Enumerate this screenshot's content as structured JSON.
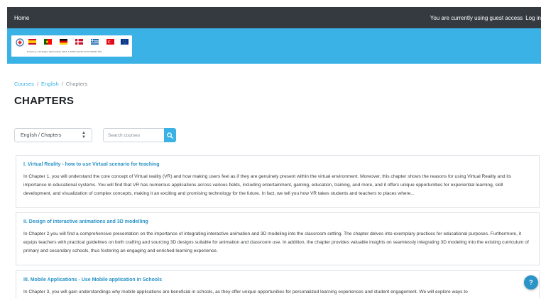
{
  "navbar": {
    "home_label": "Home",
    "guest_text": "You are currently using guest access",
    "login_label": "Log in"
  },
  "banner": {
    "logo_caption": "Erasmus+ Strategic Partnership 2021-1-DE03-KA210-SCH-000027726",
    "flag_icons": [
      "spain-flag-icon",
      "portugal-flag-icon",
      "germany-flag-icon",
      "denmark-flag-icon",
      "greece-flag-icon",
      "turkey-flag-icon",
      "eu-flag-icon"
    ]
  },
  "breadcrumb": {
    "items": [
      "Courses",
      "English",
      "Chapters"
    ],
    "separator": "/"
  },
  "page_title": "CHAPTERS",
  "filter": {
    "category_selected": "English / Chapters",
    "search_placeholder": "Search courses"
  },
  "courses": [
    {
      "title": "I. Virtual Reality - how to use Virtual scenario for teaching",
      "description": "In Chapter 1, you will understand the core concept of Virtual reality (VR) and how making users feel as if they are genuinely present within the virtual environment. Moreover, this chapter shows the reasons for using Virtual Reality and its importance in educational systems. You will find that VR has numerous applications across various fields, including entertainment, gaming, education, training, and more, and it offers unique opportunities for experiential learning, skill development, and visualization of complex concepts, making it an exciting and promising technology for the future. In fact, we tell you how VR takes students and teachers to places where..."
    },
    {
      "title": "II. Design of interactive animations and 3D modelling",
      "description": "In Chapter 2,you will find a comprehensive presentation on the importance of integrating interactive animation and 3D modeling into the classroom setting. The chapter delves into exemplary practices for educational purposes. Furthermore, it equips teachers with practical guidelines on both crafting and sourcing 3D designs suitable for animation and classroom use. In addition, the chapter provides valuable insights on seamlessly integrating 3D modeling into the existing curriculum of primary and secondary schools, thus fostering an engaging and enriched learning experience."
    },
    {
      "title": "III. Mobile Applications - Use Mobile application in Schools",
      "description": "In Chapter 3, you will gain understandings why mobile applications are beneficial in schools, as they offer unique opportunities for personalized learning experiences and student engagement. We will explore ways to"
    }
  ],
  "help_button_label": "?",
  "colors": {
    "navbar_bg": "#343a40",
    "banner_bg": "#3bb2e5",
    "link": "#2a93c7"
  }
}
